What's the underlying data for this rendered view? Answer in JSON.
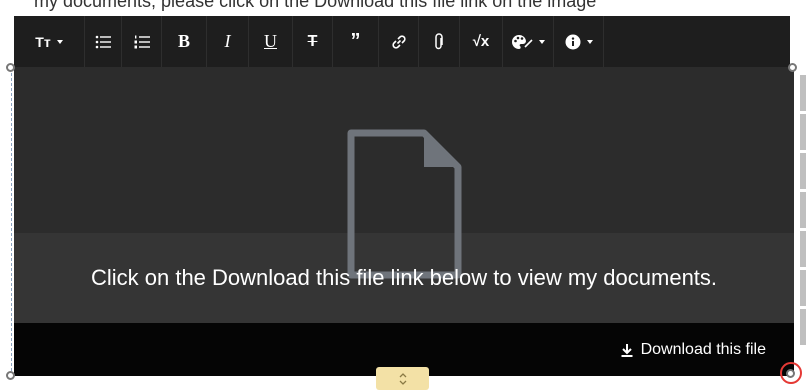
{
  "top_text": "my documents, please click on the Download this file link on the image",
  "toolbar": {
    "items": [
      {
        "name": "text-style",
        "label": "Tт"
      },
      {
        "name": "bullet-list",
        "label": "☰"
      },
      {
        "name": "numbered-list",
        "label": "☰"
      },
      {
        "name": "bold",
        "label": "B"
      },
      {
        "name": "italic",
        "label": "I"
      },
      {
        "name": "underline",
        "label": "U"
      },
      {
        "name": "strikethrough",
        "label": "T"
      },
      {
        "name": "quote",
        "label": "❞"
      },
      {
        "name": "link",
        "label": "🔗"
      },
      {
        "name": "attach",
        "label": "📎"
      },
      {
        "name": "math",
        "label": "√x"
      },
      {
        "name": "color",
        "label": ""
      },
      {
        "name": "info",
        "label": "i"
      }
    ]
  },
  "preview": {
    "message": "Click on the Download this file link below to view my documents.",
    "download_label": "Download this file"
  },
  "colors": {
    "toolbar_bg": "#1e1e1e",
    "panel_bg": "#2c2c2c",
    "panel_lower_bg": "#353535",
    "download_bar_bg": "#050505",
    "icon_gray": "#6f747b",
    "resize_tab": "#f3e1a6",
    "selection_ring": "#e53935"
  }
}
